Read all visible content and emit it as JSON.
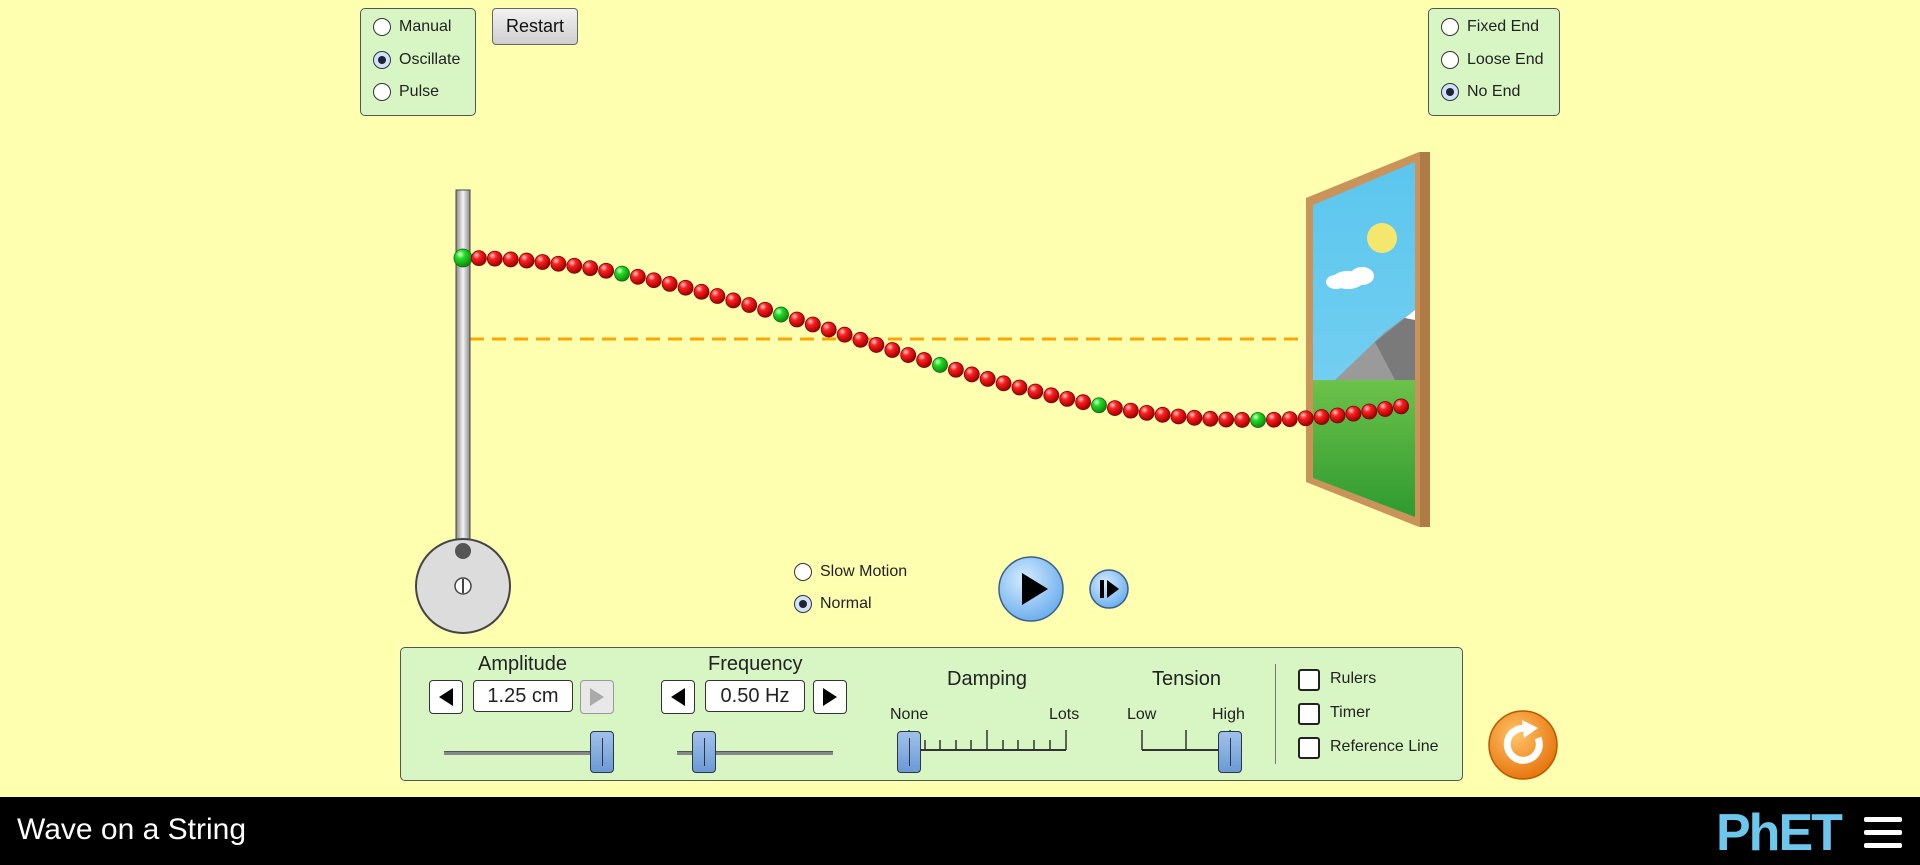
{
  "mode_panel": {
    "options": [
      {
        "label": "Manual",
        "selected": false
      },
      {
        "label": "Oscillate",
        "selected": true
      },
      {
        "label": "Pulse",
        "selected": false
      }
    ]
  },
  "restart_label": "Restart",
  "end_panel": {
    "options": [
      {
        "label": "Fixed End",
        "selected": false
      },
      {
        "label": "Loose End",
        "selected": false
      },
      {
        "label": "No End",
        "selected": true
      }
    ]
  },
  "speed": {
    "options": [
      {
        "label": "Slow Motion",
        "selected": false
      },
      {
        "label": "Normal",
        "selected": true
      }
    ]
  },
  "controls": {
    "amplitude": {
      "label": "Amplitude",
      "value": "1.25 cm",
      "slider_fraction": 0.93
    },
    "frequency": {
      "label": "Frequency",
      "value": "0.50 Hz",
      "slider_fraction": 0.17
    },
    "damping": {
      "label": "Damping",
      "min_label": "None",
      "max_label": "Lots",
      "slider_fraction": 0.0
    },
    "tension": {
      "label": "Tension",
      "min_label": "Low",
      "max_label": "High",
      "slider_fraction": 1.0
    }
  },
  "checkboxes": [
    {
      "label": "Rulers",
      "checked": false
    },
    {
      "label": "Timer",
      "checked": false
    },
    {
      "label": "Reference Line",
      "checked": false
    }
  ],
  "footer": {
    "title": "Wave on a String",
    "brand": "PhET"
  },
  "colors": {
    "background": "#ffffb0",
    "panel": "#d8f5c4",
    "bead": "#e40000",
    "bead_marker": "#22cc22",
    "reference_line": "#ffa500",
    "reset": "#f0861e"
  }
}
